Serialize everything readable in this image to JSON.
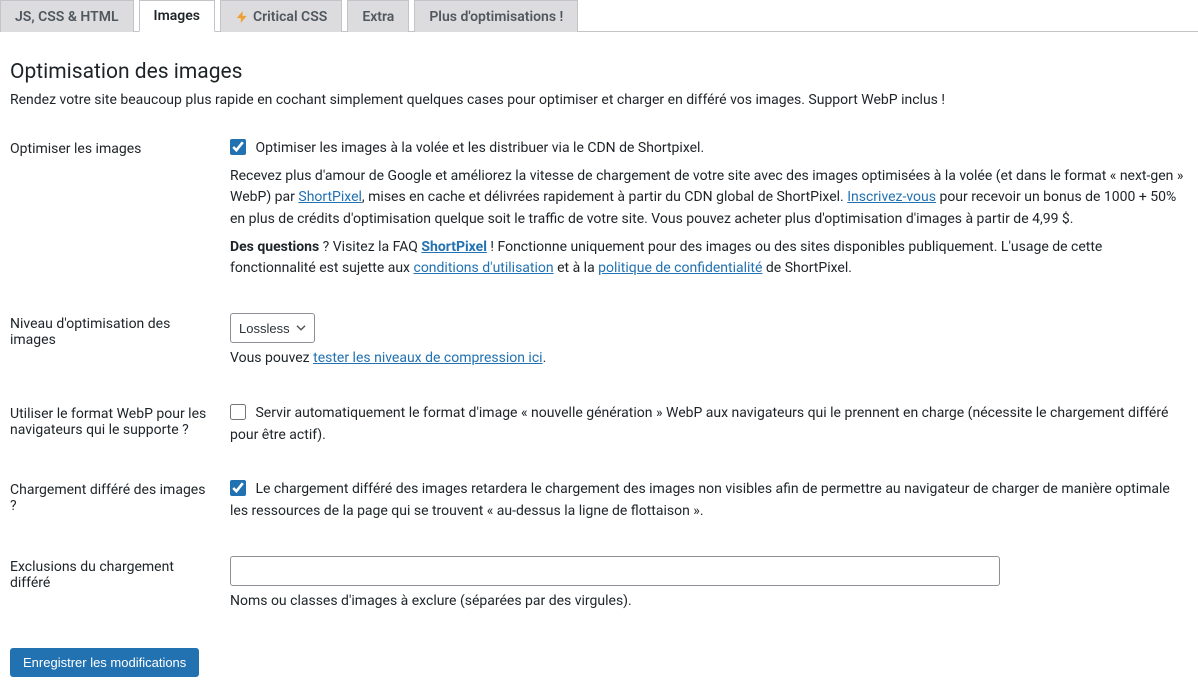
{
  "tabs": {
    "jscss": "JS, CSS & HTML",
    "images": "Images",
    "critical": "Critical CSS",
    "extra": "Extra",
    "more": "Plus d'optimisations !"
  },
  "header": {
    "title": "Optimisation des images",
    "intro": "Rendez votre site beaucoup plus rapide en cochant simplement quelques cases pour optimiser et charger en différé vos images. Support WebP inclus !"
  },
  "rows": {
    "optimize": {
      "label": "Optimiser les images",
      "checkbox_label": "Optimiser les images à la volée et les distribuer via le CDN de Shortpixel.",
      "desc1a": "Recevez plus d'amour de Google et améliorez la vitesse de chargement de votre site avec des images optimisées à la volée (et dans le format « next-gen » WebP) par ",
      "link_sp": "ShortPixel",
      "desc1b": ", mises en cache et délivrées rapidement à partir du CDN global de ShortPixel. ",
      "link_signup": "Inscrivez-vous",
      "desc1c": " pour recevoir un bonus de 1000 + 50% en plus de crédits d'optimisation quelque soit le traffic de votre site. Vous pouvez acheter plus d'optimisation d'images à partir de 4,99 $.",
      "desc2a": "Des questions",
      "desc2b": " ? Visitez la FAQ ",
      "link_faq": "ShortPixel",
      "desc2c": " ! Fonctionne uniquement pour des images ou des sites disponibles publiquement. L'usage de cette fonctionnalité est sujette aux ",
      "link_terms": "conditions d'utilisation",
      "desc2d": " et à la ",
      "link_privacy": "politique de confidentialité",
      "desc2e": " de ShortPixel."
    },
    "level": {
      "label": "Niveau d'optimisation des images",
      "selected": "Lossless",
      "help_a": "Vous pouvez ",
      "help_link": "tester les niveaux de compression ici",
      "help_b": "."
    },
    "webp": {
      "label": "Utiliser le format WebP pour les navigateurs qui le supporte ?",
      "checkbox_label": "Servir automatiquement le format d'image « nouvelle génération » WebP aux navigateurs qui le prennent en charge (nécessite le chargement différé pour être actif)."
    },
    "lazy": {
      "label": "Chargement différé des images ?",
      "checkbox_label": "Le chargement différé des images retardera le chargement des images non visibles afin de permettre au navigateur de charger de manière optimale les ressources de la page qui se trouvent « au-dessus la ligne de flottaison »."
    },
    "exclusions": {
      "label": "Exclusions du chargement différé",
      "value": "",
      "help": "Noms ou classes d'images à exclure (séparées par des virgules)."
    }
  },
  "submit": {
    "label": "Enregistrer les modifications"
  }
}
